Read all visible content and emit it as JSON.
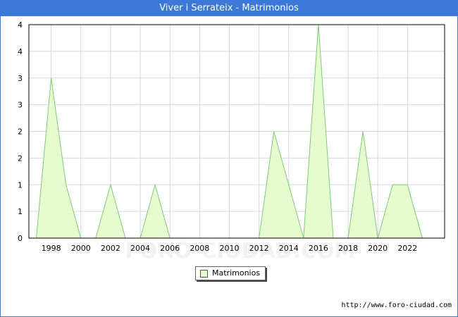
{
  "window": {
    "title": "Viver i Serrateix - Matrimonios"
  },
  "chart_data": {
    "type": "area",
    "title": "Viver i Serrateix - Matrimonios",
    "x": [
      1997,
      1998,
      1999,
      2000,
      2001,
      2002,
      2003,
      2004,
      2005,
      2006,
      2007,
      2008,
      2009,
      2010,
      2011,
      2012,
      2013,
      2014,
      2015,
      2016,
      2017,
      2018,
      2019,
      2020,
      2021,
      2022,
      2023
    ],
    "series": [
      {
        "name": "Matrimonios",
        "values": [
          0,
          3,
          1,
          0,
          0,
          1,
          0,
          0,
          1,
          0,
          0,
          0,
          0,
          0,
          0,
          0,
          2,
          1,
          0,
          4,
          0,
          0,
          2,
          0,
          1,
          1,
          0
        ]
      }
    ],
    "x_tick_labels": [
      "1998",
      "2000",
      "2002",
      "2004",
      "2006",
      "2008",
      "2010",
      "2012",
      "2014",
      "2016",
      "2018",
      "2020",
      "2022"
    ],
    "y_tick_labels": [
      "0",
      "1",
      "1",
      "2",
      "2",
      "3",
      "3",
      "4",
      "4"
    ],
    "ylim": [
      0,
      4
    ],
    "xlabel": "",
    "ylabel": "",
    "grid": true,
    "legend_position": "bottom-center",
    "colors": {
      "fill": "#e6fccc",
      "line": "#80c880",
      "grid": "#d8d8d8",
      "title_bar": "#3b78d8"
    }
  },
  "legend": {
    "label": "Matrimonios"
  },
  "watermark": "FORO-CIUDAD.COM",
  "footer": {
    "source": "http://www.foro-ciudad.com"
  }
}
